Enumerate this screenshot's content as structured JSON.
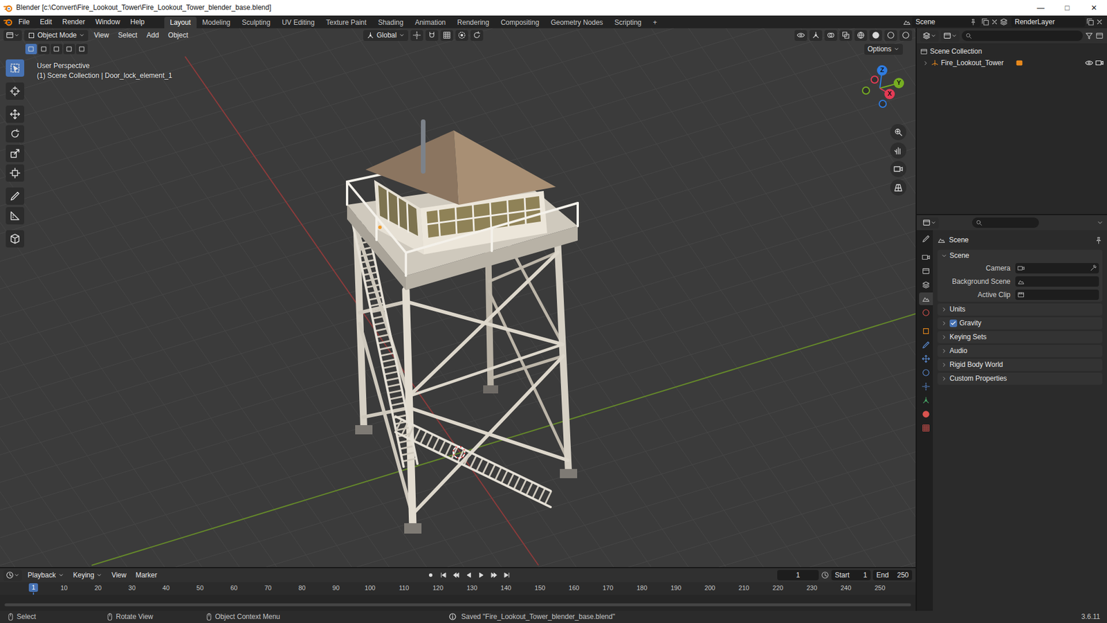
{
  "window": {
    "title": "Blender [c:\\Convert\\Fire_Lookout_Tower\\Fire_Lookout_Tower_blender_base.blend]",
    "controls": [
      "—",
      "□",
      "✕"
    ]
  },
  "menu": [
    "File",
    "Edit",
    "Render",
    "Window",
    "Help"
  ],
  "workspaces": [
    {
      "label": "Layout",
      "selected": true
    },
    {
      "label": "Modeling",
      "selected": false
    },
    {
      "label": "Sculpting",
      "selected": false
    },
    {
      "label": "UV Editing",
      "selected": false
    },
    {
      "label": "Texture Paint",
      "selected": false
    },
    {
      "label": "Shading",
      "selected": false
    },
    {
      "label": "Animation",
      "selected": false
    },
    {
      "label": "Rendering",
      "selected": false
    },
    {
      "label": "Compositing",
      "selected": false
    },
    {
      "label": "Geometry Nodes",
      "selected": false
    },
    {
      "label": "Scripting",
      "selected": false
    }
  ],
  "add_workspace": "+",
  "scene_selector": {
    "scene": "Scene",
    "view_layer": "RenderLayer"
  },
  "viewport": {
    "mode": "Object Mode",
    "menus": [
      "View",
      "Select",
      "Add",
      "Object"
    ],
    "orientation": "Global",
    "options": "Options",
    "view_name": "User Perspective",
    "context": "(1) Scene Collection | Door_lock_element_1",
    "gizmo_axes": [
      {
        "label": "Z",
        "color": "#2f7ce0"
      },
      {
        "label": "Y",
        "color": "#76ad22"
      },
      {
        "label": "X",
        "color": "#e53b55"
      }
    ],
    "tools": [
      {
        "name": "select",
        "selected": true
      },
      {
        "name": "cursor",
        "selected": false
      },
      {
        "name": "move",
        "selected": false
      },
      {
        "name": "rotate",
        "selected": false
      },
      {
        "name": "scale",
        "selected": false
      },
      {
        "name": "transform",
        "selected": false
      },
      {
        "name": "annotate",
        "selected": false
      },
      {
        "name": "measure",
        "selected": false
      },
      {
        "name": "add-cube",
        "selected": false
      }
    ]
  },
  "outliner": {
    "root": "Scene Collection",
    "items": [
      {
        "label": "Fire_Lookout_Tower",
        "expanded": false,
        "visible": true
      }
    ]
  },
  "properties": {
    "tabs": [
      {
        "name": "tool",
        "selected": false
      },
      {
        "name": "render",
        "selected": false
      },
      {
        "name": "output",
        "selected": false
      },
      {
        "name": "view-layer",
        "selected": false
      },
      {
        "name": "scene",
        "selected": true
      },
      {
        "name": "world",
        "selected": false
      },
      {
        "name": "object",
        "selected": false
      },
      {
        "name": "modifiers",
        "selected": false
      },
      {
        "name": "particles",
        "selected": false
      },
      {
        "name": "physics",
        "selected": false
      },
      {
        "name": "constraints",
        "selected": false
      },
      {
        "name": "data",
        "selected": false
      },
      {
        "name": "material",
        "selected": false
      },
      {
        "name": "texture",
        "selected": false
      }
    ],
    "context": "Scene",
    "panels": [
      {
        "label": "Scene",
        "expanded": true,
        "kind": "fields",
        "fields": [
          "Camera",
          "Background Scene",
          "Active Clip"
        ]
      },
      {
        "label": "Units",
        "expanded": false,
        "kind": "plain"
      },
      {
        "label": "Gravity",
        "expanded": false,
        "kind": "checkbox",
        "checked": true
      },
      {
        "label": "Keying Sets",
        "expanded": false,
        "kind": "plain"
      },
      {
        "label": "Audio",
        "expanded": false,
        "kind": "plain"
      },
      {
        "label": "Rigid Body World",
        "expanded": false,
        "kind": "plain"
      },
      {
        "label": "Custom Properties",
        "expanded": false,
        "kind": "plain"
      }
    ]
  },
  "timeline": {
    "menus": [
      "Playback",
      "Keying",
      "View",
      "Marker"
    ],
    "current_frame": "1",
    "start_label": "Start",
    "start": "1",
    "end_label": "End",
    "end": "250",
    "playhead": "1",
    "ticks": [
      "10",
      "20",
      "30",
      "40",
      "50",
      "60",
      "70",
      "80",
      "90",
      "100",
      "110",
      "120",
      "130",
      "140",
      "150",
      "160",
      "170",
      "180",
      "190",
      "200",
      "210",
      "220",
      "230",
      "240",
      "250"
    ]
  },
  "status_bar": {
    "hints": [
      "Select",
      "Rotate View",
      "Object Context Menu"
    ],
    "message": "Saved \"Fire_Lookout_Tower_blender_base.blend\"",
    "version": "3.6.11"
  }
}
